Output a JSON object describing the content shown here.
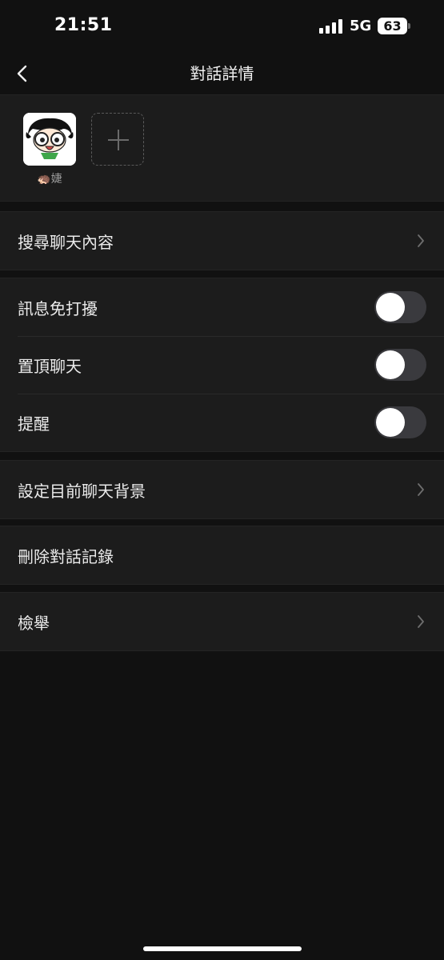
{
  "status": {
    "time": "21:51",
    "network": "5G",
    "battery": "63"
  },
  "nav": {
    "title": "對話詳情"
  },
  "members": [
    {
      "name": "🦔婕"
    }
  ],
  "search_row": {
    "label": "搜尋聊天內容"
  },
  "toggles": [
    {
      "label": "訊息免打擾",
      "on": false
    },
    {
      "label": "置頂聊天",
      "on": false
    },
    {
      "label": "提醒",
      "on": false
    }
  ],
  "background_row": {
    "label": "設定目前聊天背景"
  },
  "delete_row": {
    "label": "刪除對話記錄"
  },
  "report_row": {
    "label": "檢舉"
  },
  "colors": {
    "background": "#111111",
    "cell": "#1c1c1c",
    "toggle_off": "#3a3a3e"
  }
}
